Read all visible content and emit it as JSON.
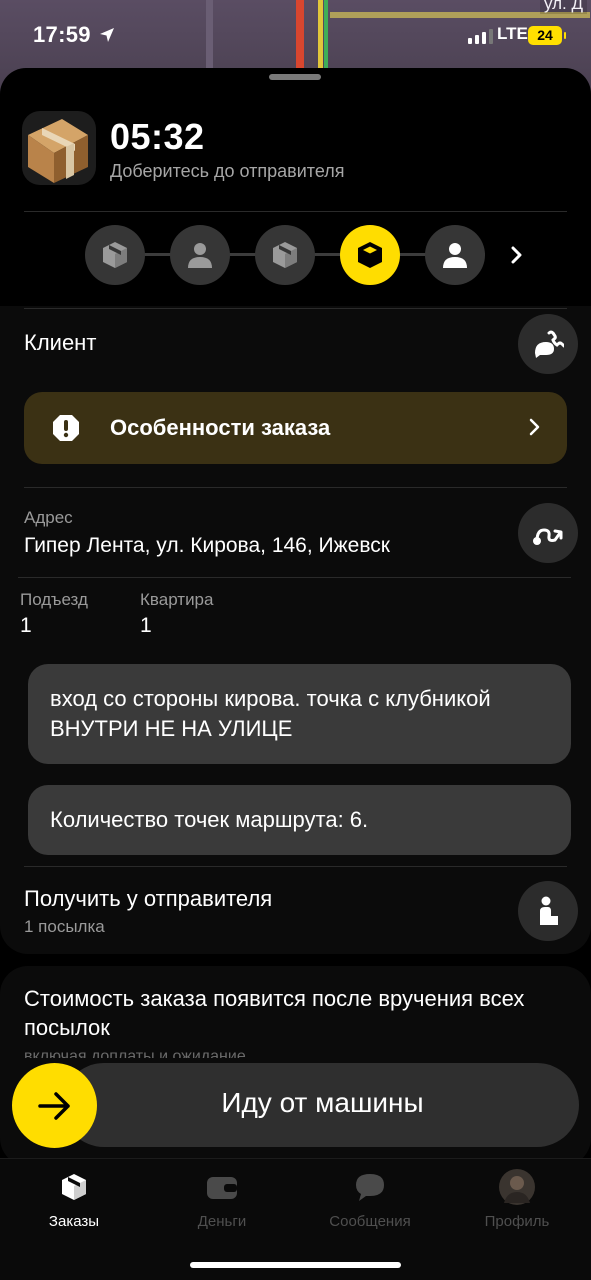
{
  "status_bar": {
    "time": "17:59",
    "network": "LTE",
    "battery": "24"
  },
  "map": {
    "street_label": "ул. Д"
  },
  "order": {
    "timer": "05:32",
    "instruction": "Доберитесь до отправителя",
    "steps": [
      {
        "icon": "package-icon",
        "state": "done"
      },
      {
        "icon": "person-icon",
        "state": "done"
      },
      {
        "icon": "package-icon",
        "state": "done"
      },
      {
        "icon": "package-icon",
        "state": "active"
      },
      {
        "icon": "person-icon",
        "state": "pending"
      }
    ]
  },
  "client": {
    "label": "Клиент"
  },
  "features": {
    "label": "Особенности заказа"
  },
  "address": {
    "label": "Адрес",
    "value": "Гипер Лента, ул. Кирова, 146, Ижевск",
    "entrance_label": "Подъезд",
    "entrance_value": "1",
    "apartment_label": "Квартира",
    "apartment_value": "1"
  },
  "comments": [
    "вход со стороны кирова. точка с клубникой ВНУТРИ НЕ НА УЛИЦЕ",
    "Количество точек маршрута: 6."
  ],
  "pickup": {
    "title": "Получить у отправителя",
    "subtitle": "1 посылка"
  },
  "price_card": {
    "text": "Стоимость заказа появится после вручения всех посылок",
    "faded_text": "включая доплаты и ожидание"
  },
  "action_button": {
    "label": "Иду от машины"
  },
  "tabs": [
    {
      "label": "Заказы",
      "icon": "orders-icon",
      "active": true
    },
    {
      "label": "Деньги",
      "icon": "wallet-icon",
      "active": false
    },
    {
      "label": "Сообщения",
      "icon": "chat-icon",
      "active": false
    },
    {
      "label": "Профиль",
      "icon": "avatar-icon",
      "active": false
    }
  ],
  "colors": {
    "accent": "#ffdd00",
    "background": "#000000",
    "card": "#3a3a3a",
    "warning_bg": "#3b3114"
  }
}
